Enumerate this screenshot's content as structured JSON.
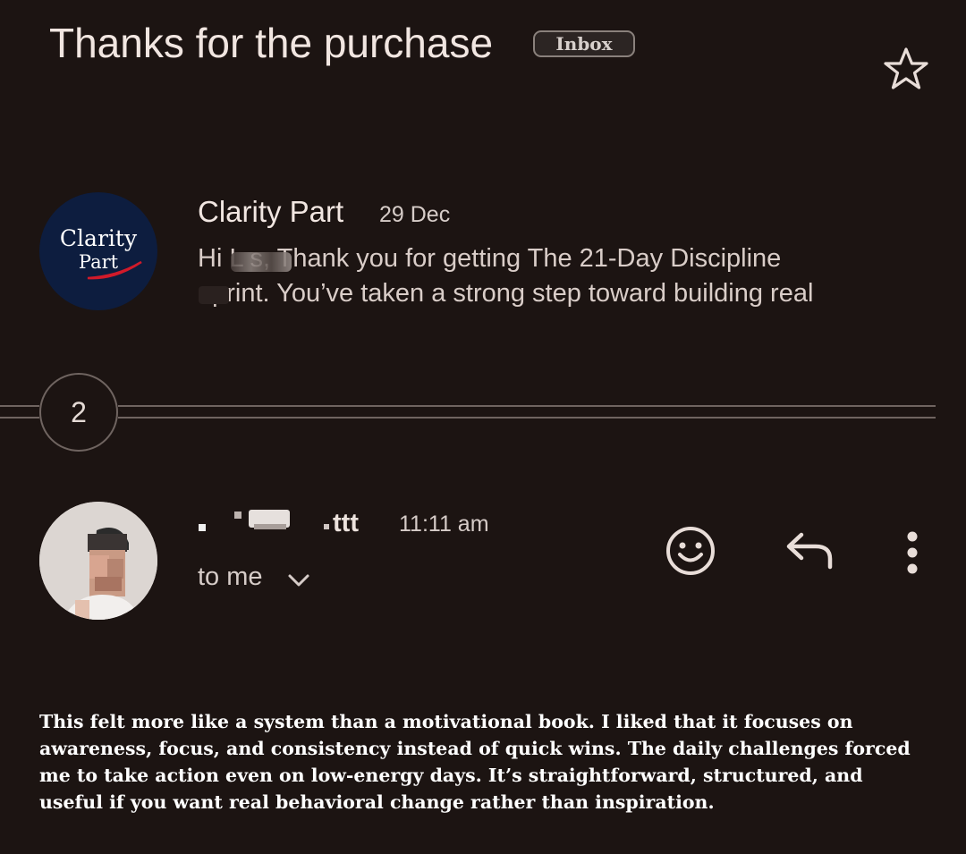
{
  "thread": {
    "subject": "Thanks for the purchase",
    "label_badge": "Inbox",
    "collapsed_count": "2"
  },
  "message_first": {
    "avatar_logo_line1": "Clarity",
    "avatar_logo_line2": "Part",
    "sender": "Clarity Part",
    "date": "29 Dec",
    "snippet_lines": [
      "Hi L   s, Thank you for getting The 21-Day Discipline",
      "    eprint. You’ve taken a strong step toward building real"
    ]
  },
  "message_latest": {
    "sender_visible": "ttt",
    "time": "11:11 am",
    "recipient_label": "to me",
    "body_lines": [
      "This felt more like a system than a motivational book. I liked that it focuses on",
      "awareness, focus, and consistency instead of quick wins. The daily challenges forced",
      "me to take action even on low-energy days. It’s straightforward, structured, and",
      "useful if you want real behavioral change rather than inspiration."
    ]
  },
  "icons": {
    "star": "star-outline-icon",
    "emoji": "emoji-smile-icon",
    "reply": "reply-arrow-icon",
    "more": "more-vertical-icon",
    "expand": "chevron-down-icon"
  },
  "colors": {
    "background": "#1c1412",
    "logo_background": "#0d1d3f",
    "logo_accent": "#d11a2a"
  }
}
